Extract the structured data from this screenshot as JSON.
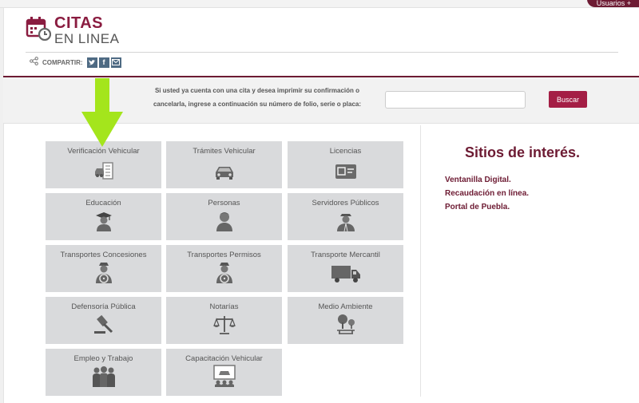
{
  "header": {
    "user_menu": "Usuarios +",
    "logo_line1": "CITAS",
    "logo_line2": "EN LINEA",
    "share_label": "COMPARTIR:",
    "share_buttons": [
      "twitter-icon",
      "facebook-icon",
      "email-icon"
    ]
  },
  "search": {
    "prompt_line1": "Si usted ya cuenta con una cita y desea imprimir su confirmación o",
    "prompt_line2": "cancelarla, ingrese a continuación su número de folio, serie o placa:",
    "input_value": "",
    "button_label": "Buscar"
  },
  "services": [
    {
      "label": "Verificación Vehicular",
      "icon": "vehicle-inspection-icon"
    },
    {
      "label": "Trámites Vehicular",
      "icon": "car-icon"
    },
    {
      "label": "Licencias",
      "icon": "license-card-icon"
    },
    {
      "label": "Educación",
      "icon": "graduate-icon"
    },
    {
      "label": "Personas",
      "icon": "person-icon"
    },
    {
      "label": "Servidores Públicos",
      "icon": "public-servant-icon"
    },
    {
      "label": "Transportes Concesiones",
      "icon": "driver-icon"
    },
    {
      "label": "Transportes Permisos",
      "icon": "driver-icon"
    },
    {
      "label": "Transporte Mercantil",
      "icon": "truck-icon"
    },
    {
      "label": "Defensoría Pública",
      "icon": "gavel-icon"
    },
    {
      "label": "Notarías",
      "icon": "scales-icon"
    },
    {
      "label": "Medio Ambiente",
      "icon": "environment-icon"
    },
    {
      "label": "Empleo y Trabajo",
      "icon": "team-icon"
    },
    {
      "label": "Capacitación Vehicular",
      "icon": "vehicle-training-icon"
    }
  ],
  "sites": {
    "title": "Sitios de interés.",
    "links": [
      "Ventanilla Digital.",
      "Recaudación en línea.",
      "Portal de Puebla."
    ]
  },
  "colors": {
    "brand": "#8a1c40",
    "dark_brand": "#6d1b33",
    "button": "#a41e45",
    "tile": "#d9dadc",
    "arrow": "#a4e51c"
  }
}
